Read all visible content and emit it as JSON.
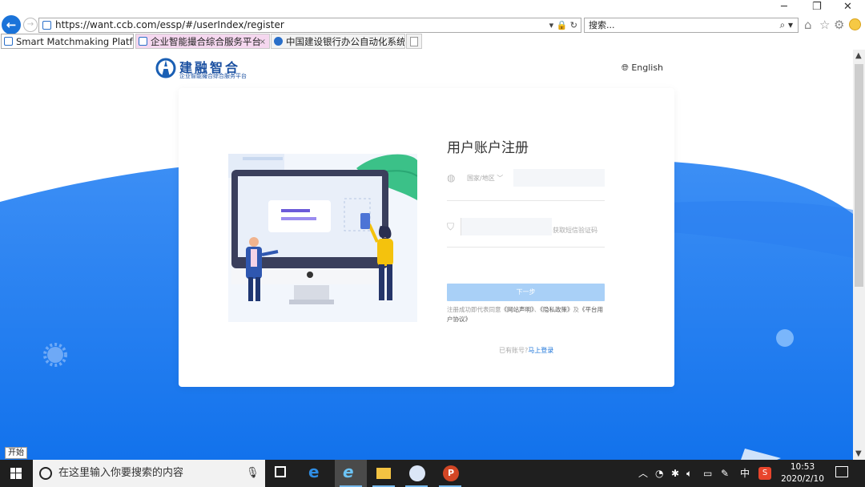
{
  "browser": {
    "url": "https://want.ccb.com/essp/#/userIndex/register",
    "search_placeholder": "搜索...",
    "address_tools": "▾ 🔒 ↻",
    "tabs": [
      {
        "label": "Smart Matchmaking Platform",
        "active": true
      },
      {
        "label": "企业智能撮合综合服务平台",
        "active": false
      },
      {
        "label": "中国建设银行办公自动化系统",
        "active": false
      }
    ],
    "tab_close": "×"
  },
  "header": {
    "logo_title": "建融智合",
    "logo_subtitle": "企业智能撮合综合服务平台",
    "language": "English"
  },
  "form": {
    "title": "用户账户注册",
    "country_label": "国家/地区",
    "phone_value": "",
    "code_value": "",
    "get_code_link": "获取短信验证码",
    "next_button": "下一步",
    "agreement_prefix": "注册成功即代表同意",
    "agreement_site": "《网站声明》",
    "agreement_sep": "、",
    "agreement_privacy": "《隐私政策》",
    "agreement_and": "及",
    "agreement_platform": "《平台用户协议》",
    "login_prompt": "已有账号?",
    "login_link": "马上登录"
  },
  "taskbar": {
    "start_tip": "开始",
    "search_placeholder": "在这里输入你要搜索的内容",
    "ime": "中",
    "time": "10:53",
    "date": "2020/2/10"
  },
  "colors": {
    "brand_blue": "#1a7ff0",
    "link_blue": "#1a73d9",
    "button_disabled": "#a9d0f7"
  }
}
